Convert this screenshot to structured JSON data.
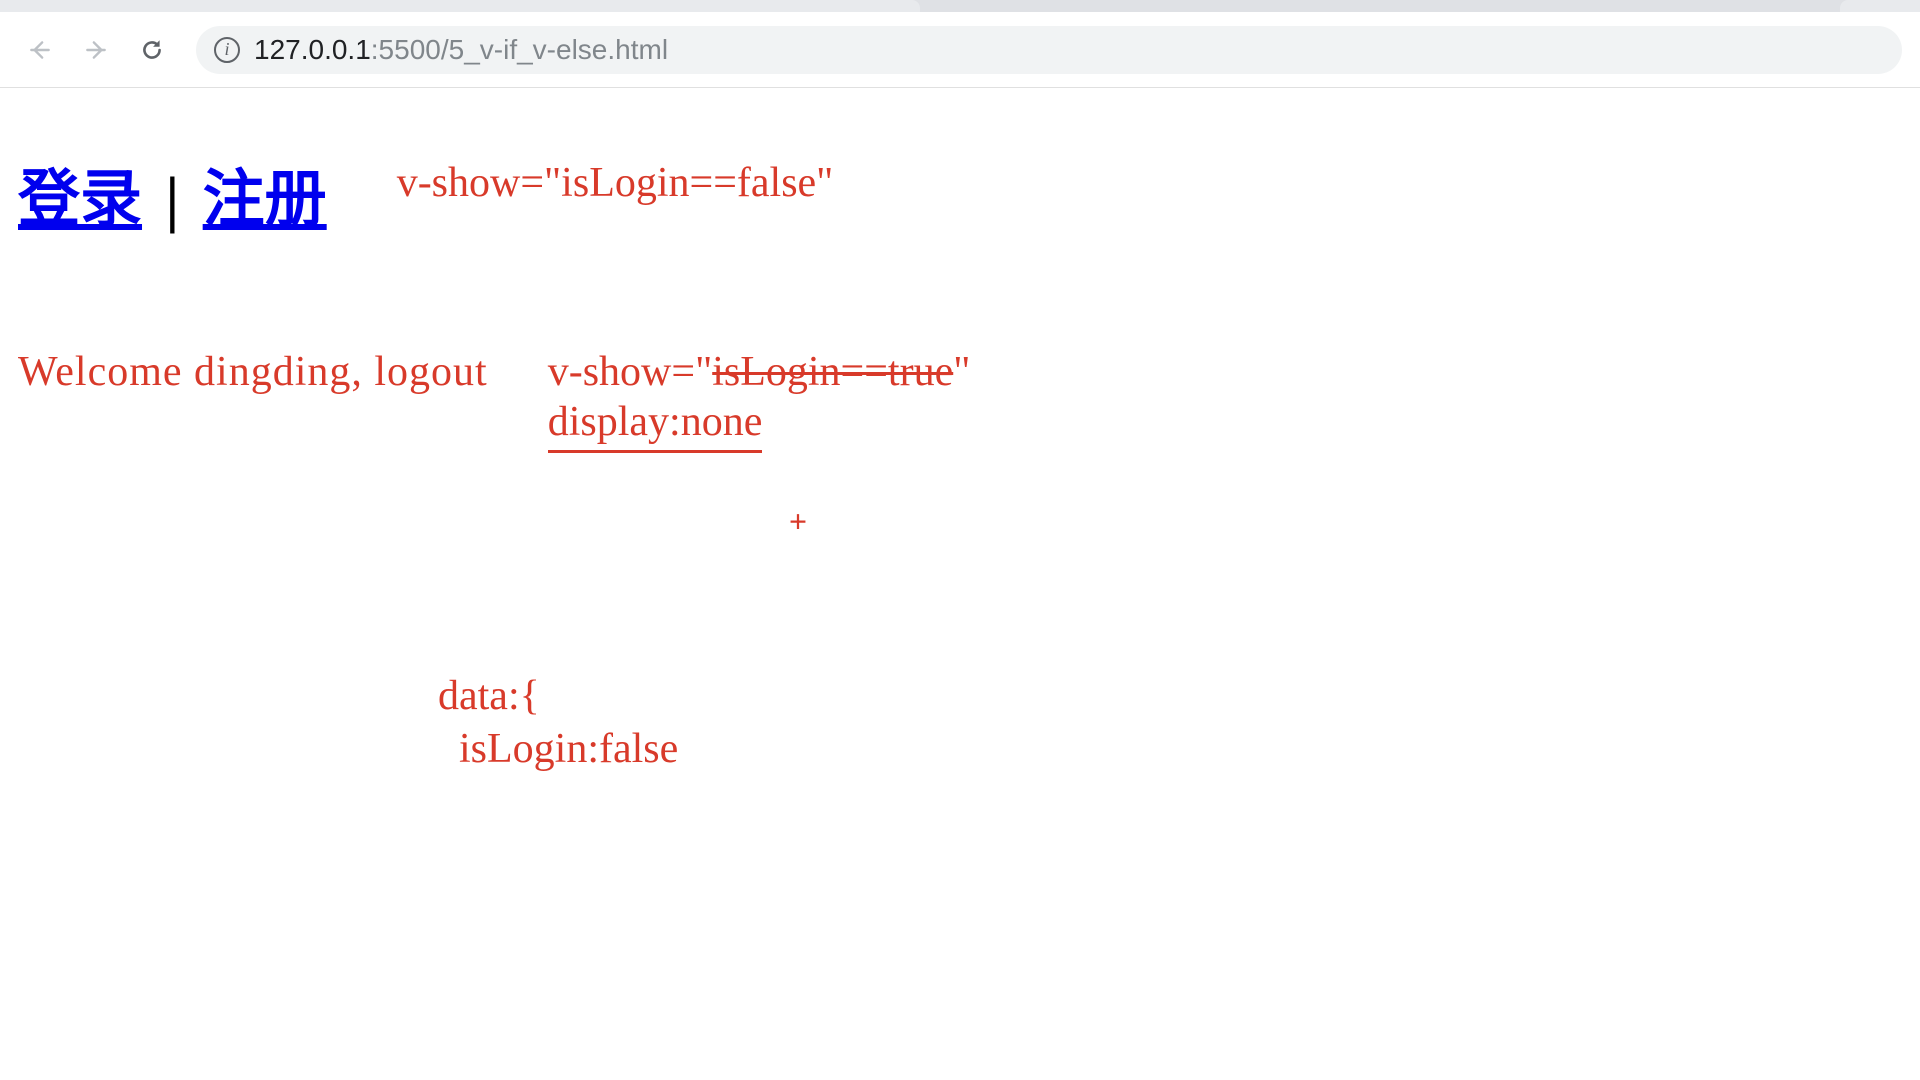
{
  "browser": {
    "url_host": "127.0.0.1",
    "url_port_path": ":5500/5_v-if_v-else.html"
  },
  "header": {
    "login": "登录",
    "sep": " | ",
    "register": "注册",
    "annot_vshow_false": "v-show=\"isLogin==false\""
  },
  "row2": {
    "welcome": "Welcome dingding, logout",
    "vshow_prefix": "v-show=\"",
    "vshow_strike": "isLogin==true",
    "vshow_suffix": "\"",
    "display_none": "display:none"
  },
  "plus": "+",
  "data_block": "data:{\n  isLogin:false"
}
